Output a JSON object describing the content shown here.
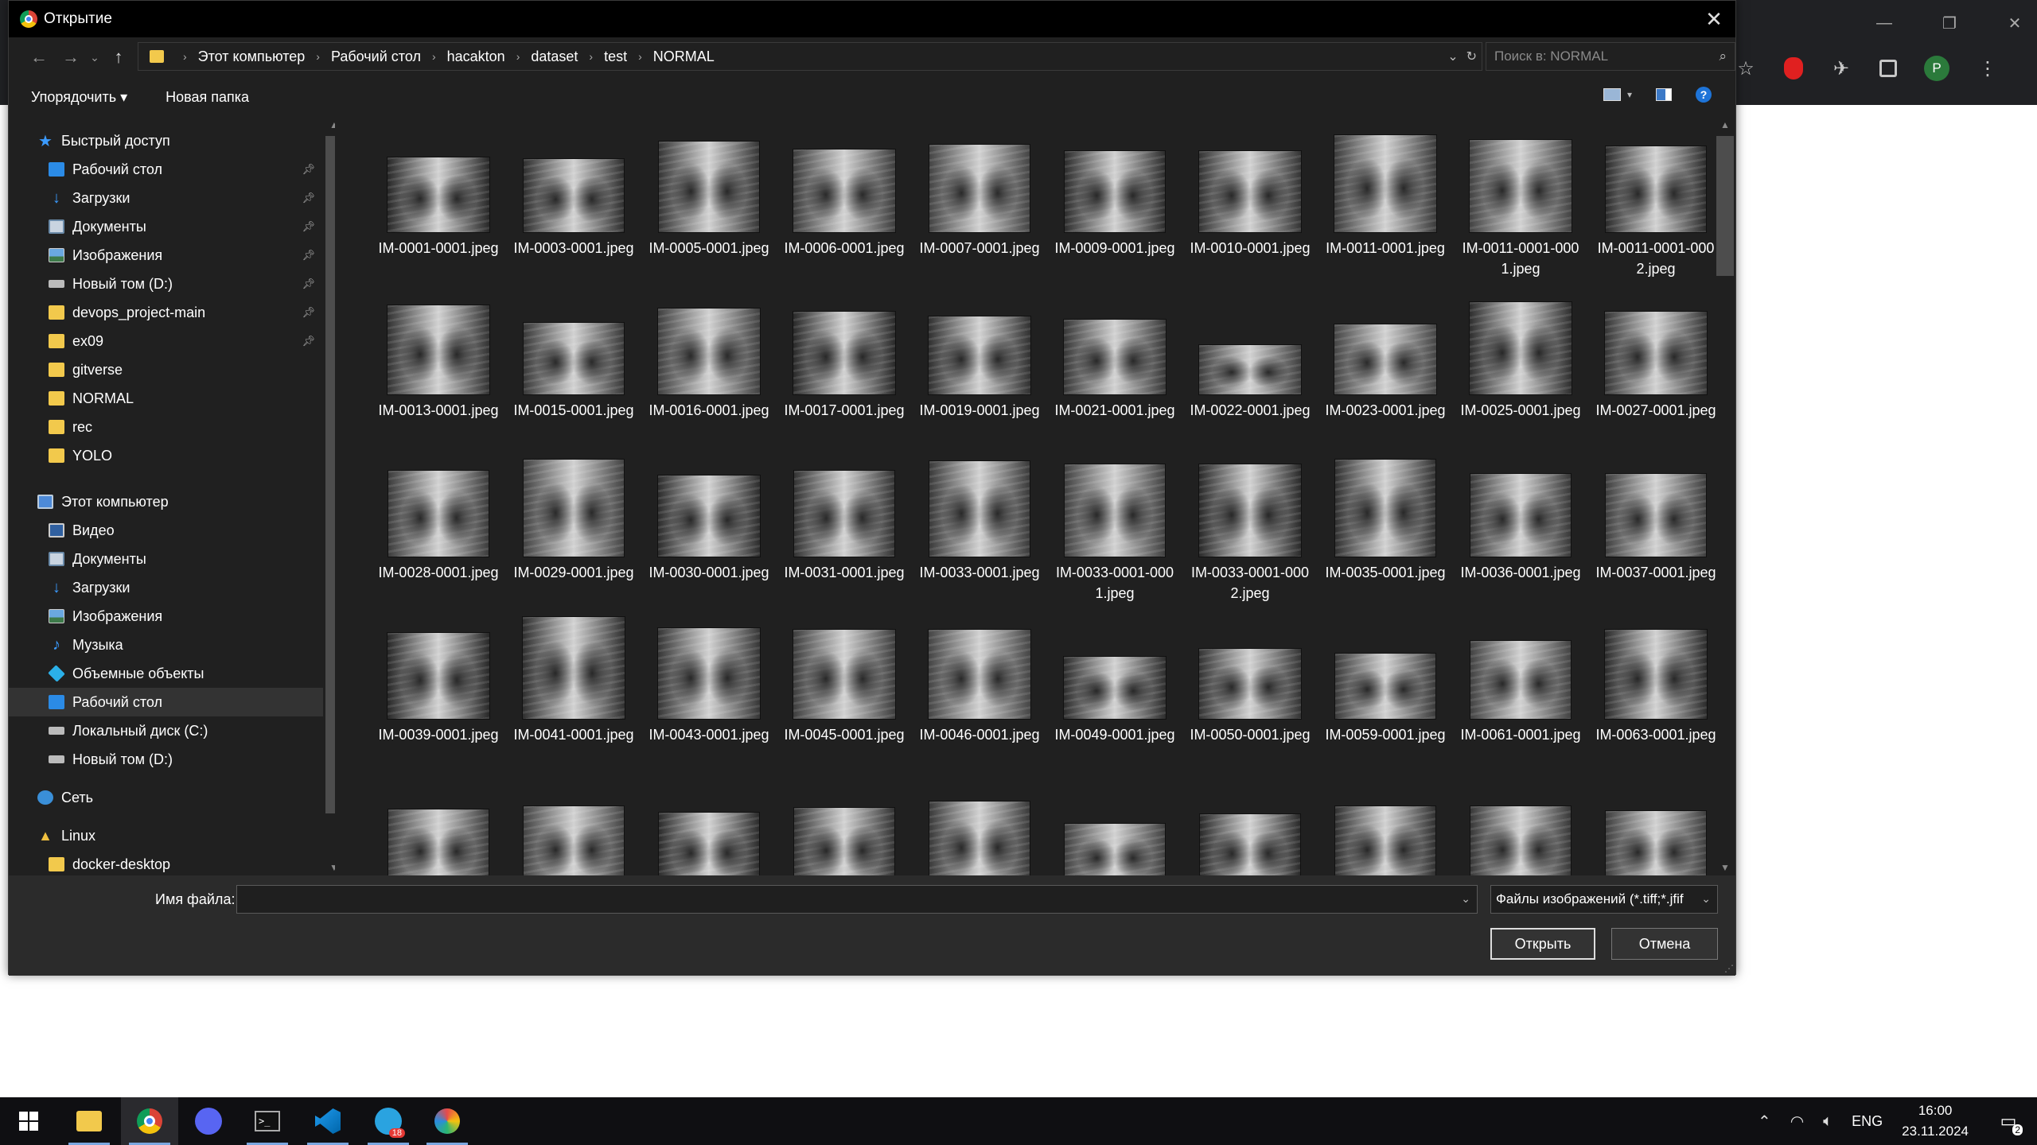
{
  "dialog": {
    "title": "Открытие",
    "close_glyph": "✕"
  },
  "address": {
    "crumbs": [
      "Этот компьютер",
      "Рабочий стол",
      "hacakton",
      "dataset",
      "test",
      "NORMAL"
    ],
    "search_placeholder": "Поиск в: NORMAL"
  },
  "commands": {
    "organize": "Упорядочить ▾",
    "new_folder": "Новая папка"
  },
  "nav": {
    "quick_access": "Быстрый доступ",
    "quick_items": [
      {
        "label": "Рабочий стол",
        "icon": "desktop-icon",
        "pinned": true
      },
      {
        "label": "Загрузки",
        "icon": "downloads-icon",
        "pinned": true
      },
      {
        "label": "Документы",
        "icon": "documents-icon",
        "pinned": true
      },
      {
        "label": "Изображения",
        "icon": "pictures-icon",
        "pinned": true
      },
      {
        "label": "Новый том (D:)",
        "icon": "drive-icon",
        "pinned": true
      },
      {
        "label": "devops_project-main",
        "icon": "folder-icon",
        "pinned": true
      },
      {
        "label": "ex09",
        "icon": "folder-icon",
        "pinned": true
      },
      {
        "label": "gitverse",
        "icon": "folder-icon",
        "pinned": false
      },
      {
        "label": "NORMAL",
        "icon": "folder-icon",
        "pinned": false
      },
      {
        "label": "rec",
        "icon": "folder-icon",
        "pinned": false
      },
      {
        "label": "YOLO",
        "icon": "folder-icon",
        "pinned": false
      }
    ],
    "this_pc": "Этот компьютер",
    "pc_items": [
      {
        "label": "Видео",
        "icon": "video-icon"
      },
      {
        "label": "Документы",
        "icon": "documents-icon"
      },
      {
        "label": "Загрузки",
        "icon": "downloads-icon"
      },
      {
        "label": "Изображения",
        "icon": "pictures-icon"
      },
      {
        "label": "Музыка",
        "icon": "music-icon"
      },
      {
        "label": "Объемные объекты",
        "icon": "3d-objects-icon"
      },
      {
        "label": "Рабочий стол",
        "icon": "desktop-icon",
        "selected": true
      },
      {
        "label": "Локальный диск (C:)",
        "icon": "drive-icon"
      },
      {
        "label": "Новый том (D:)",
        "icon": "drive-icon"
      }
    ],
    "network": "Сеть",
    "linux": "Linux",
    "docker": "docker-desktop"
  },
  "files": [
    "IM-0001-0001.jpeg",
    "IM-0003-0001.jpeg",
    "IM-0005-0001.jpeg",
    "IM-0006-0001.jpeg",
    "IM-0007-0001.jpeg",
    "IM-0009-0001.jpeg",
    "IM-0010-0001.jpeg",
    "IM-0011-0001.jpeg",
    "IM-0011-0001-0001.jpeg",
    "IM-0011-0001-0002.jpeg",
    "IM-0013-0001.jpeg",
    "IM-0015-0001.jpeg",
    "IM-0016-0001.jpeg",
    "IM-0017-0001.jpeg",
    "IM-0019-0001.jpeg",
    "IM-0021-0001.jpeg",
    "IM-0022-0001.jpeg",
    "IM-0023-0001.jpeg",
    "IM-0025-0001.jpeg",
    "IM-0027-0001.jpeg",
    "IM-0028-0001.jpeg",
    "IM-0029-0001.jpeg",
    "IM-0030-0001.jpeg",
    "IM-0031-0001.jpeg",
    "IM-0033-0001.jpeg",
    "IM-0033-0001-0001.jpeg",
    "IM-0033-0001-0002.jpeg",
    "IM-0035-0001.jpeg",
    "IM-0036-0001.jpeg",
    "IM-0037-0001.jpeg",
    "IM-0039-0001.jpeg",
    "IM-0041-0001.jpeg",
    "IM-0043-0001.jpeg",
    "IM-0045-0001.jpeg",
    "IM-0046-0001.jpeg",
    "IM-0049-0001.jpeg",
    "IM-0050-0001.jpeg",
    "IM-0059-0001.jpeg",
    "IM-0061-0001.jpeg",
    "IM-0063-0001.jpeg"
  ],
  "partial_row_count": 10,
  "bottom": {
    "filename_label": "Имя файла:",
    "filename_value": "",
    "filter": "Файлы изображений (*.tiff;*.jfif",
    "open": "Открыть",
    "cancel": "Отмена"
  },
  "taskbar": {
    "lang": "ENG",
    "time": "16:00",
    "date": "23.11.2024",
    "telegram_badge": "18",
    "notifications": "2",
    "chrome_avatar": "P"
  }
}
